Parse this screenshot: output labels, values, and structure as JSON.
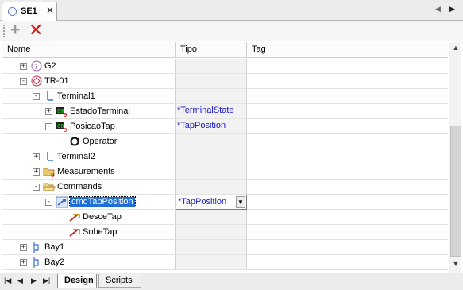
{
  "window": {
    "tab_title": "SE1",
    "tab_close": "✕",
    "tab_scroll_prev": "◀",
    "tab_scroll_next": "▶"
  },
  "toolbar": {
    "add_label": "+",
    "delete_label": "✕"
  },
  "grid": {
    "columns": [
      "Nome",
      "Tipo",
      "Tag"
    ],
    "rows": [
      {
        "name": "G2",
        "tipo": "",
        "icon": "generator-icon",
        "expander": "+",
        "indent": 0
      },
      {
        "name": "TR-01",
        "tipo": "",
        "icon": "transformer-icon",
        "expander": "−",
        "indent": 0
      },
      {
        "name": "Terminal1",
        "tipo": "",
        "icon": "terminal-icon",
        "expander": "−",
        "indent": 1
      },
      {
        "name": "EstadoTerminal",
        "tipo": "*TerminalState",
        "icon": "measurement-icon",
        "expander": "+",
        "indent": 2
      },
      {
        "name": "PosicaoTap",
        "tipo": "*TapPosition",
        "icon": "measurement-icon",
        "expander": "−",
        "indent": 2
      },
      {
        "name": "Operator",
        "tipo": "",
        "icon": "operator-icon",
        "expander": "",
        "indent": 3
      },
      {
        "name": "Terminal2",
        "tipo": "",
        "icon": "terminal-icon",
        "expander": "+",
        "indent": 1
      },
      {
        "name": "Measurements",
        "tipo": "",
        "icon": "folder-icon",
        "expander": "+",
        "indent": 1
      },
      {
        "name": "Commands",
        "tipo": "",
        "icon": "folder-open-icon",
        "expander": "−",
        "indent": 1
      },
      {
        "name": "cmdTapPosition",
        "tipo": "*TapPosition",
        "icon": "command-icon",
        "expander": "−",
        "indent": 2,
        "selected": true
      },
      {
        "name": "DesceTap",
        "tipo": "",
        "icon": "action-icon",
        "expander": "",
        "indent": 3
      },
      {
        "name": "SobeTap",
        "tipo": "",
        "icon": "action-icon",
        "expander": "",
        "indent": 3
      },
      {
        "name": "Bay1",
        "tipo": "",
        "icon": "bay-icon",
        "expander": "+",
        "indent": 0
      },
      {
        "name": "Bay2",
        "tipo": "",
        "icon": "bay-icon",
        "expander": "+",
        "indent": 0
      }
    ]
  },
  "bottom": {
    "nav_first": "|◀",
    "nav_prev": "◀",
    "nav_next": "▶",
    "nav_last": "▶|",
    "tabs": [
      "Design",
      "Scripts"
    ]
  },
  "scrollbar": {
    "up": "▲",
    "down": "▼"
  }
}
